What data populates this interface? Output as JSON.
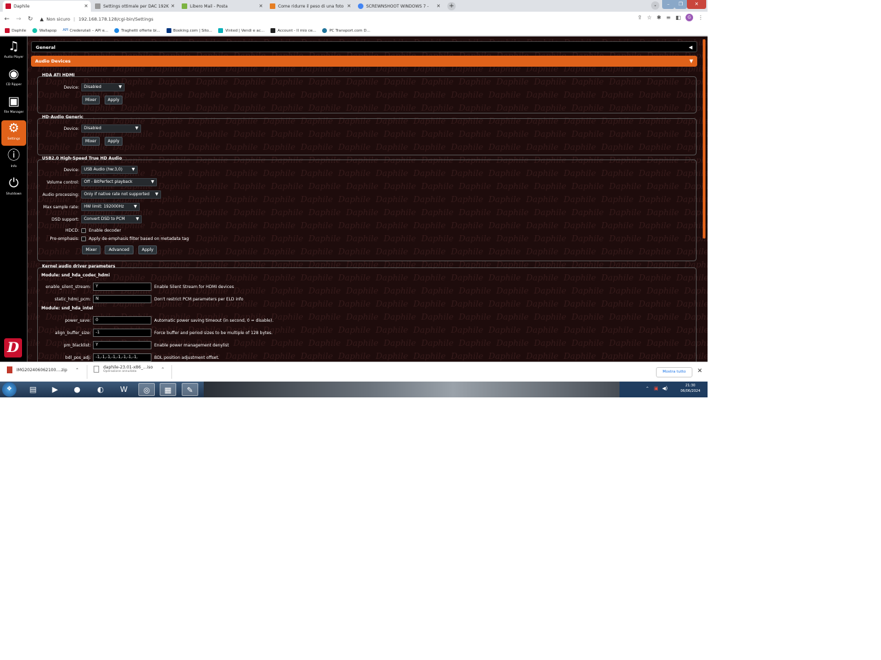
{
  "browser": {
    "tabs": [
      {
        "title": "Daphile",
        "active": true
      },
      {
        "title": "Settings ottimale per DAC 192K"
      },
      {
        "title": "Libero Mail - Posta"
      },
      {
        "title": "Come ridurre il peso di una foto"
      },
      {
        "title": "SCREWNSHOOT WINDOWS 7 -"
      }
    ],
    "address": {
      "security": "Non sicuro",
      "url": "192.168.178.128/cgi-bin/Settings"
    },
    "profile_initial": "G",
    "bookmarks": [
      "Daphile",
      "Wallapop",
      "Credenziali – API e...",
      "Traghetti offerte bi...",
      "Booking.com | Sito...",
      "Vinted | Vendi e ac...",
      "Account - Il mio ce...",
      "PC Transport.com D..."
    ]
  },
  "sidebar": [
    {
      "label": "Audio Player",
      "icon": "music-note-icon"
    },
    {
      "label": "CD Ripper",
      "icon": "cd-icon"
    },
    {
      "label": "File Manager",
      "icon": "box-icon"
    },
    {
      "label": "Settings",
      "icon": "gears-icon",
      "active": true
    },
    {
      "label": "Info",
      "icon": "info-icon"
    },
    {
      "label": "Shutdown",
      "icon": "power-icon"
    }
  ],
  "logo": {
    "letter": "D",
    "text": "Daphile"
  },
  "sections": {
    "general": "General",
    "audio_devices": "Audio Devices"
  },
  "hda_ati": {
    "title": "HDA ATI HDMI",
    "device_label": "Device:",
    "device_value": "Disabled",
    "mixer": "Mixer",
    "apply": "Apply"
  },
  "hda_generic": {
    "title": "HD-Audio Generic",
    "device_label": "Device:",
    "device_value": "Disabled",
    "mixer": "Mixer",
    "apply": "Apply"
  },
  "usb": {
    "title": "USB2.0 High-Speed True HD Audio",
    "device_label": "Device:",
    "device_value": "USB Audio (hw:3,0)",
    "volume_label": "Volume control:",
    "volume_value": "Off - BitPerfect playback",
    "processing_label": "Audio processing:",
    "processing_value": "Only if native rate not supported",
    "rate_label": "Max sample rate:",
    "rate_value": "HW limit: 192000Hz",
    "dsd_label": "DSD support:",
    "dsd_value": "Convert DSD to PCM",
    "hdcd_label": "HDCD:",
    "hdcd_text": "Enable decoder",
    "preemph_label": "Pre-emphasis:",
    "preemph_text": "Apply de-emphasis filter based on metadata tag",
    "mixer": "Mixer",
    "advanced": "Advanced",
    "apply": "Apply"
  },
  "kernel": {
    "title": "Kernel audio driver parameters",
    "module1": "Module: snd_hda_codec_hdmi",
    "module2": "Module: snd_hda_intel",
    "params": [
      {
        "name": "enable_silent_stream:",
        "value": "Y",
        "desc": "Enable Silent Stream for HDMI devices"
      },
      {
        "name": "static_hdmi_pcm:",
        "value": "N",
        "desc": "Don't restrict PCM parameters per ELD info"
      },
      {
        "name": "power_save:",
        "value": "0",
        "desc": "Automatic power saving timeout (in second, 0 = disable)."
      },
      {
        "name": "align_buffer_size:",
        "value": "-1",
        "desc": "Force buffer and period sizes to be multiple of 128 bytes."
      },
      {
        "name": "pm_blacklist:",
        "value": "Y",
        "desc": "Enable power management denylist"
      },
      {
        "name": "bdl_pos_adj:",
        "value": "-1,-1,-1,-1,-1,-1,-1,-1,",
        "desc": "BDL position adjustment offset."
      }
    ]
  },
  "watermark": "Daphile",
  "downloads": {
    "item1": "IMG20240606210​0....zip",
    "item2_name": "daphile-23.01-x86_...iso",
    "item2_status": "Operazione annullata",
    "show_all": "Mostra tutto"
  },
  "taskbar": {
    "time": "21:30",
    "date": "06/06/2024"
  }
}
